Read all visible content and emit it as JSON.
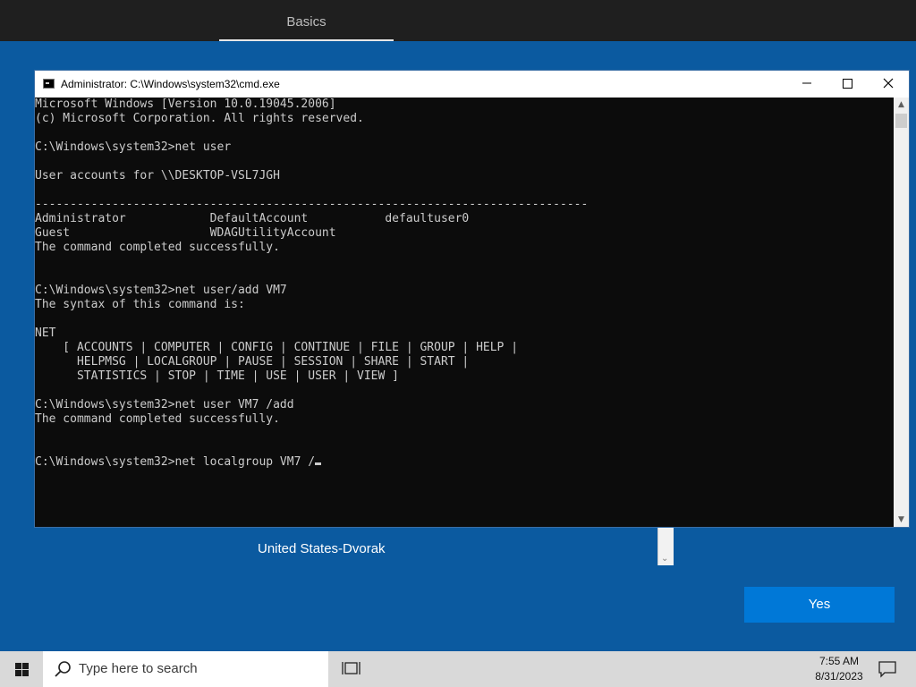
{
  "oobe": {
    "tab_label": "Basics",
    "keyboard_layout": "United States-Dvorak",
    "yes_label": "Yes"
  },
  "cmd": {
    "title": "Administrator: C:\\Windows\\system32\\cmd.exe",
    "lines": [
      "Microsoft Windows [Version 10.0.19045.2006]",
      "(c) Microsoft Corporation. All rights reserved.",
      "",
      "C:\\Windows\\system32>net user",
      "",
      "User accounts for \\\\DESKTOP-VSL7JGH",
      "",
      "-------------------------------------------------------------------------------",
      "Administrator            DefaultAccount           defaultuser0",
      "Guest                    WDAGUtilityAccount",
      "The command completed successfully.",
      "",
      "",
      "C:\\Windows\\system32>net user/add VM7",
      "The syntax of this command is:",
      "",
      "NET",
      "    [ ACCOUNTS | COMPUTER | CONFIG | CONTINUE | FILE | GROUP | HELP |",
      "      HELPMSG | LOCALGROUP | PAUSE | SESSION | SHARE | START |",
      "      STATISTICS | STOP | TIME | USE | USER | VIEW ]",
      "",
      "C:\\Windows\\system32>net user VM7 /add",
      "The command completed successfully.",
      "",
      "",
      "C:\\Windows\\system32>net localgroup VM7 /"
    ]
  },
  "taskbar": {
    "search_placeholder": "Type here to search",
    "time": "7:55 AM",
    "date": "8/31/2023",
    "icons": [
      "windows-start-icon",
      "search-icon",
      "task-view-icon",
      "notification-icon"
    ]
  }
}
